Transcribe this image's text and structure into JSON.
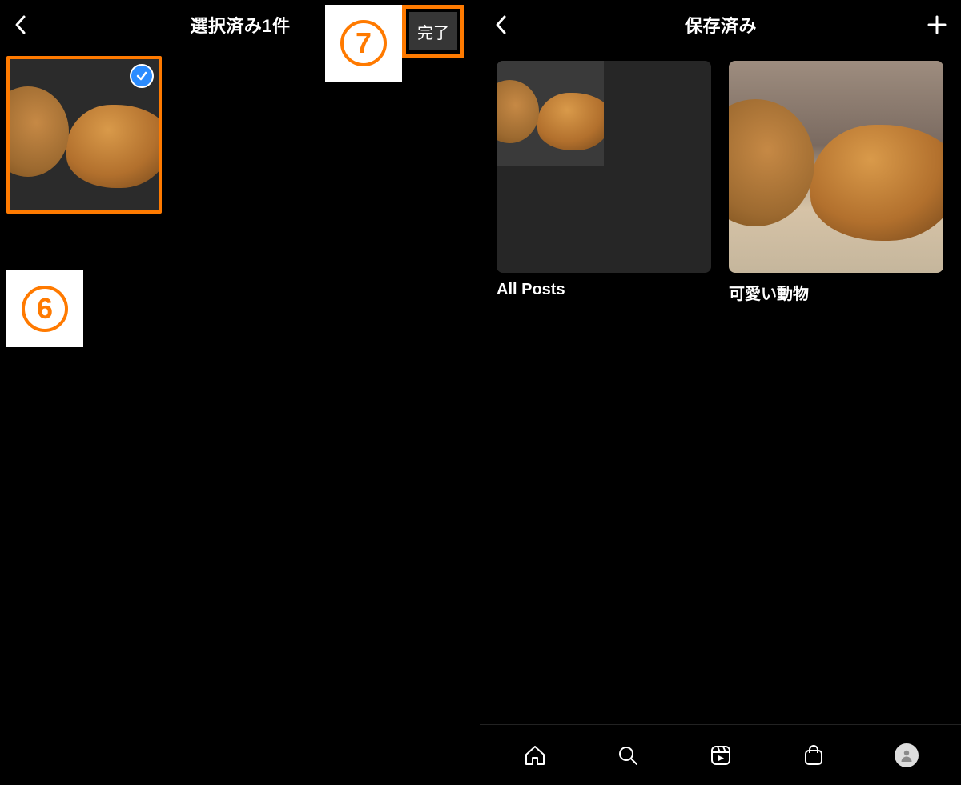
{
  "left": {
    "title": "選択済み1件",
    "done_label": "完了",
    "annotation_6": "6",
    "annotation_7": "7"
  },
  "right": {
    "title": "保存済み",
    "collections": [
      {
        "label": "All Posts"
      },
      {
        "label": "可愛い動物"
      }
    ]
  },
  "colors": {
    "accent": "#ff7a00",
    "check": "#2b8cff"
  }
}
